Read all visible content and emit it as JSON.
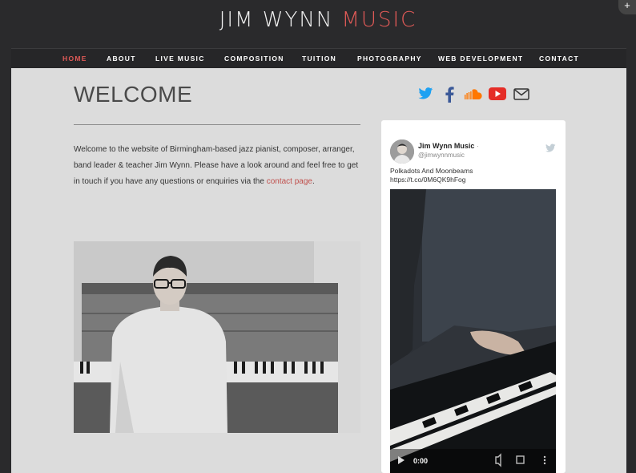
{
  "header": {
    "logo_part1": "JIM WYNN",
    "logo_part2": "MUSIC",
    "corner_button": "+"
  },
  "nav": {
    "items": [
      "HOME",
      "ABOUT",
      "LIVE MUSIC",
      "COMPOSITION",
      "TUITION",
      "PHOTOGRAPHY",
      "WEB DEVELOPMENT",
      "CONTACT"
    ],
    "active": "HOME"
  },
  "main": {
    "title": "WELCOME",
    "intro_text": "Welcome to the website of Birmingham-based jazz pianist, composer, arranger, band leader & teacher Jim Wynn. Please have a look around and feel free to get in touch if you have any questions or enquiries via the ",
    "intro_link": "contact page",
    "intro_end": "."
  },
  "social": {
    "icons": [
      "twitter-icon",
      "facebook-icon",
      "soundcloud-icon",
      "youtube-icon",
      "email-icon"
    ]
  },
  "tweet": {
    "name": "Jim Wynn Music",
    "name_suffix": "·",
    "handle": "@jimwynnmusic",
    "text_line1": "Polkadots And Moonbeams",
    "text_line2": "https://t.co/0M6QK9hFog",
    "video_time": "0:00"
  },
  "colors": {
    "accent": "#e05a57",
    "header_bg": "#2a2a2c",
    "content_bg": "#dcdcdc",
    "twitter_blue": "#1da1f2",
    "facebook_blue": "#3b5998",
    "soundcloud_orange": "#ff7700",
    "youtube_red": "#e52d27"
  }
}
